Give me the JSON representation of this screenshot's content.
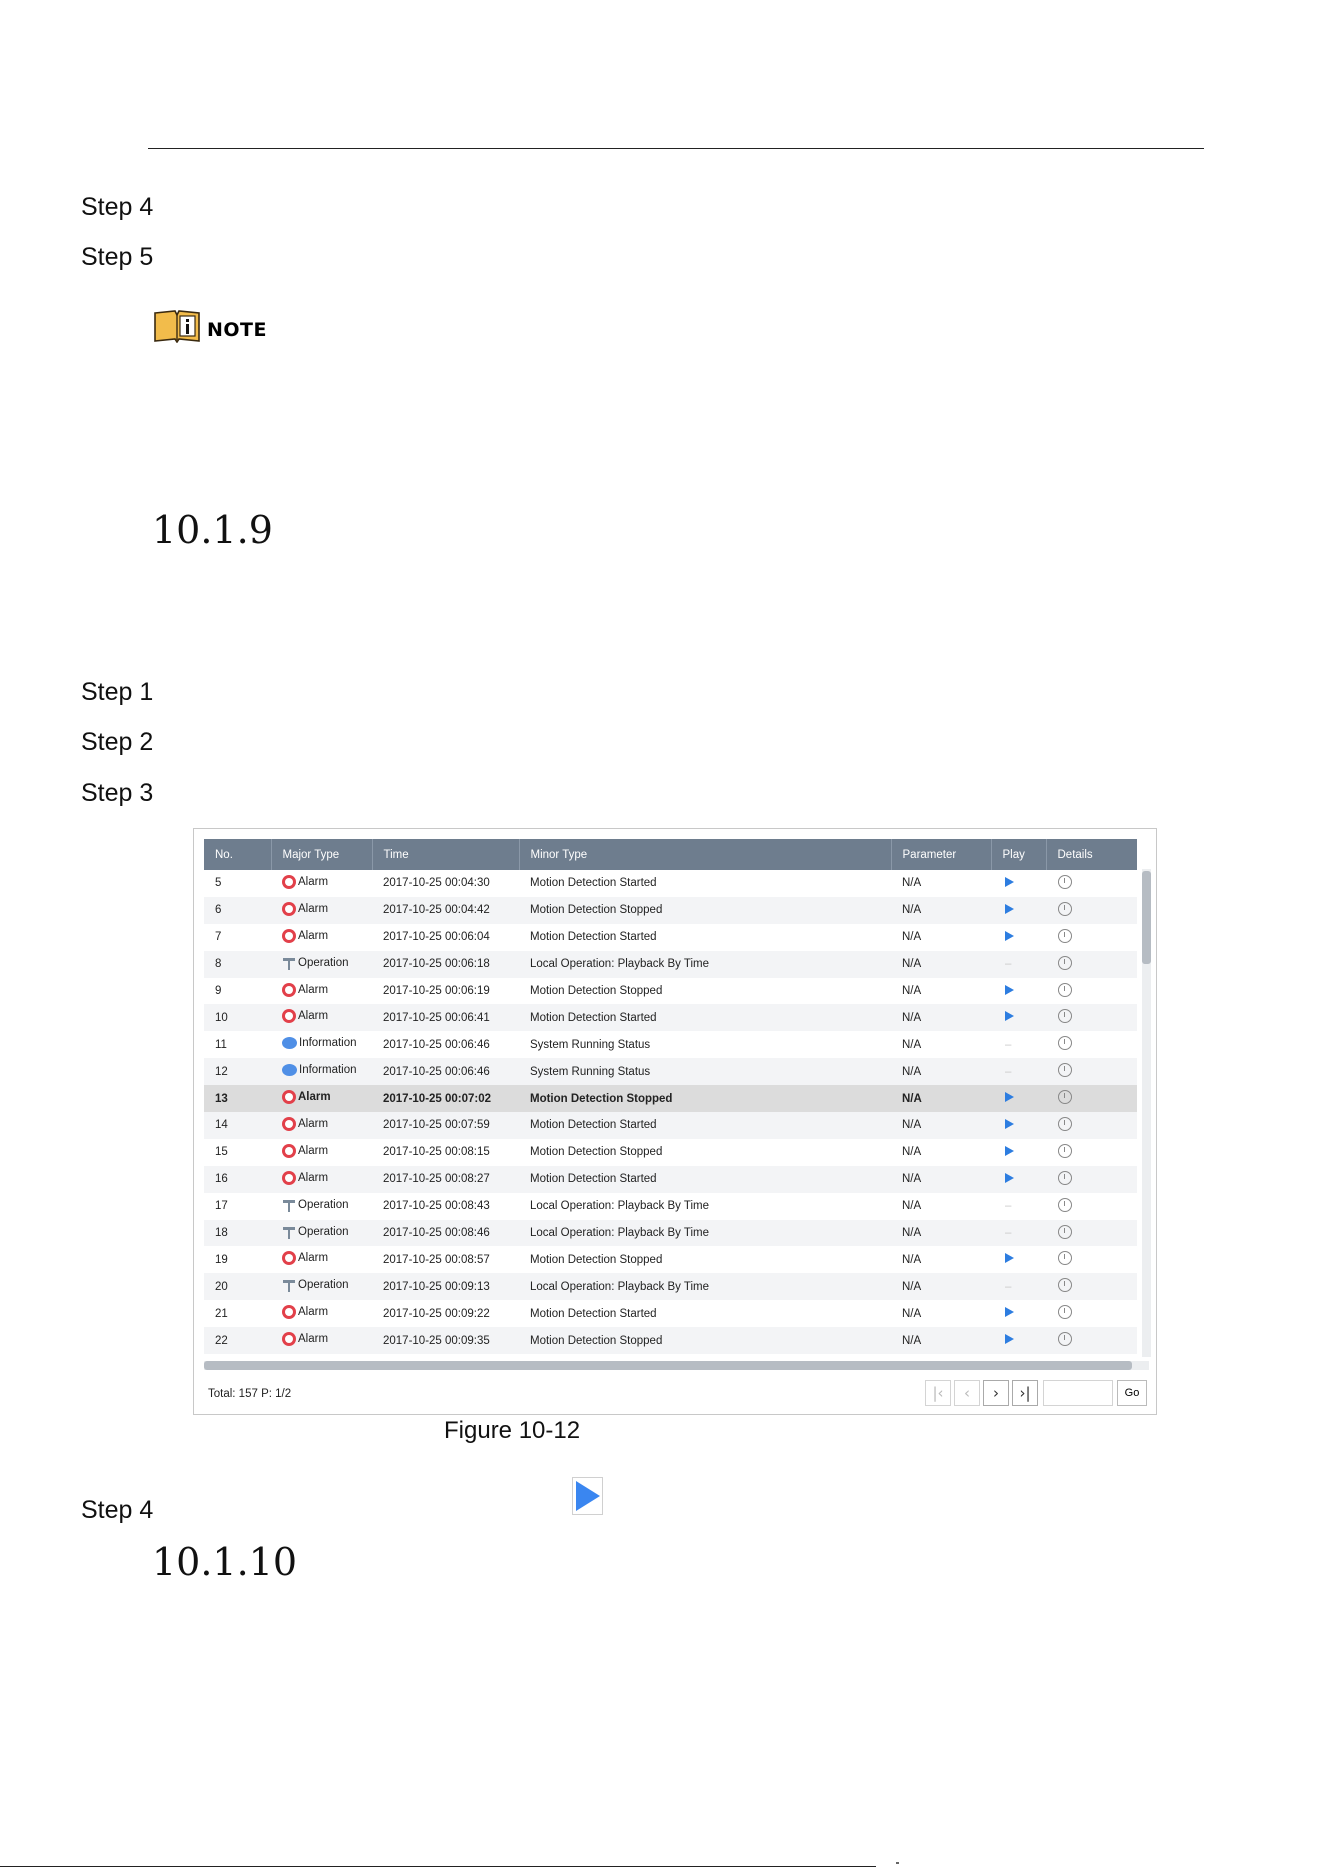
{
  "steps": {
    "s4_top": "Step 4",
    "s5": "Step 5",
    "s1": "Step 1",
    "s2": "Step 2",
    "s3": "Step 3",
    "s4_bottom": "Step 4"
  },
  "note_label": "NOTE",
  "sections": {
    "first": "10.1.9",
    "second": "10.1.10"
  },
  "table": {
    "headers": [
      "No.",
      "Major Type",
      "Time",
      "Minor Type",
      "Parameter",
      "Play",
      "Details"
    ],
    "rows": [
      {
        "no": "5",
        "major": "Alarm",
        "icon": "alarm-icon",
        "time": "2017-10-25 00:04:30",
        "minor": "Motion Detection Started",
        "param": "N/A",
        "play": true
      },
      {
        "no": "6",
        "major": "Alarm",
        "icon": "alarm-icon",
        "time": "2017-10-25 00:04:42",
        "minor": "Motion Detection Stopped",
        "param": "N/A",
        "play": true
      },
      {
        "no": "7",
        "major": "Alarm",
        "icon": "alarm-icon",
        "time": "2017-10-25 00:06:04",
        "minor": "Motion Detection Started",
        "param": "N/A",
        "play": true
      },
      {
        "no": "8",
        "major": "Operation",
        "icon": "operation-icon",
        "time": "2017-10-25 00:06:18",
        "minor": "Local Operation: Playback By Time",
        "param": "N/A",
        "play": false
      },
      {
        "no": "9",
        "major": "Alarm",
        "icon": "alarm-icon",
        "time": "2017-10-25 00:06:19",
        "minor": "Motion Detection Stopped",
        "param": "N/A",
        "play": true
      },
      {
        "no": "10",
        "major": "Alarm",
        "icon": "alarm-icon",
        "time": "2017-10-25 00:06:41",
        "minor": "Motion Detection Started",
        "param": "N/A",
        "play": true
      },
      {
        "no": "11",
        "major": "Information",
        "icon": "information-icon",
        "time": "2017-10-25 00:06:46",
        "minor": "System Running Status",
        "param": "N/A",
        "play": false
      },
      {
        "no": "12",
        "major": "Information",
        "icon": "information-icon",
        "time": "2017-10-25 00:06:46",
        "minor": "System Running Status",
        "param": "N/A",
        "play": false
      },
      {
        "no": "13",
        "major": "Alarm",
        "icon": "alarm-icon",
        "time": "2017-10-25 00:07:02",
        "minor": "Motion Detection Stopped",
        "param": "N/A",
        "play": true,
        "selected": true
      },
      {
        "no": "14",
        "major": "Alarm",
        "icon": "alarm-icon",
        "time": "2017-10-25 00:07:59",
        "minor": "Motion Detection Started",
        "param": "N/A",
        "play": true
      },
      {
        "no": "15",
        "major": "Alarm",
        "icon": "alarm-icon",
        "time": "2017-10-25 00:08:15",
        "minor": "Motion Detection Stopped",
        "param": "N/A",
        "play": true
      },
      {
        "no": "16",
        "major": "Alarm",
        "icon": "alarm-icon",
        "time": "2017-10-25 00:08:27",
        "minor": "Motion Detection Started",
        "param": "N/A",
        "play": true
      },
      {
        "no": "17",
        "major": "Operation",
        "icon": "operation-icon",
        "time": "2017-10-25 00:08:43",
        "minor": "Local Operation: Playback By Time",
        "param": "N/A",
        "play": false
      },
      {
        "no": "18",
        "major": "Operation",
        "icon": "operation-icon",
        "time": "2017-10-25 00:08:46",
        "minor": "Local Operation: Playback By Time",
        "param": "N/A",
        "play": false
      },
      {
        "no": "19",
        "major": "Alarm",
        "icon": "alarm-icon",
        "time": "2017-10-25 00:08:57",
        "minor": "Motion Detection Stopped",
        "param": "N/A",
        "play": true
      },
      {
        "no": "20",
        "major": "Operation",
        "icon": "operation-icon",
        "time": "2017-10-25 00:09:13",
        "minor": "Local Operation: Playback By Time",
        "param": "N/A",
        "play": false
      },
      {
        "no": "21",
        "major": "Alarm",
        "icon": "alarm-icon",
        "time": "2017-10-25 00:09:22",
        "minor": "Motion Detection Started",
        "param": "N/A",
        "play": true
      },
      {
        "no": "22",
        "major": "Alarm",
        "icon": "alarm-icon",
        "time": "2017-10-25 00:09:35",
        "minor": "Motion Detection Stopped",
        "param": "N/A",
        "play": true
      }
    ]
  },
  "footer": {
    "total": "Total: 157  P: 1/2",
    "go_label": "Go",
    "page_input_value": ""
  },
  "pager_icons": [
    "first-page-icon",
    "prev-page-icon",
    "next-page-icon",
    "last-page-icon"
  ],
  "figure_caption": "Figure 10-12",
  "colors": {
    "header_bg": "#6e7d8e",
    "alarm": "#e2404a",
    "info": "#4f8fe6",
    "play": "#2d7de0",
    "selected_row": "#dcdcdc"
  }
}
